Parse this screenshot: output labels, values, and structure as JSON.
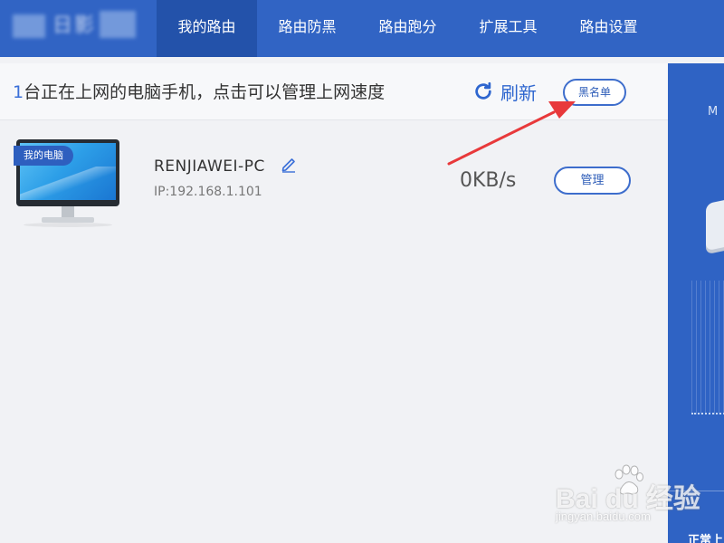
{
  "nav": {
    "logo_text": "日影",
    "items": [
      {
        "label": "我的路由",
        "active": true
      },
      {
        "label": "路由防黑",
        "active": false
      },
      {
        "label": "路由跑分",
        "active": false
      },
      {
        "label": "扩展工具",
        "active": false
      },
      {
        "label": "路由设置",
        "active": false
      }
    ]
  },
  "info": {
    "count": "1",
    "text": "台正在上网的电脑手机，点击可以管理上网速度",
    "refresh_label": "刷新",
    "blacklist_label": "黑名单"
  },
  "device": {
    "tag": "我的电脑",
    "name": "RENJIAWEI-PC",
    "ip": "IP:192.168.1.101",
    "speed": "0KB/s",
    "manage_label": "管理"
  },
  "right_panel": {
    "text_top": "M",
    "text_bottom": "正常上"
  },
  "watermark": {
    "brand": "Bai du 经验",
    "url": "jingyan.baidu.com"
  },
  "colors": {
    "nav_bg": "#3164c4",
    "nav_active": "#2352aa",
    "accent": "#2e66cf",
    "annotation_arrow": "#e8393b"
  }
}
